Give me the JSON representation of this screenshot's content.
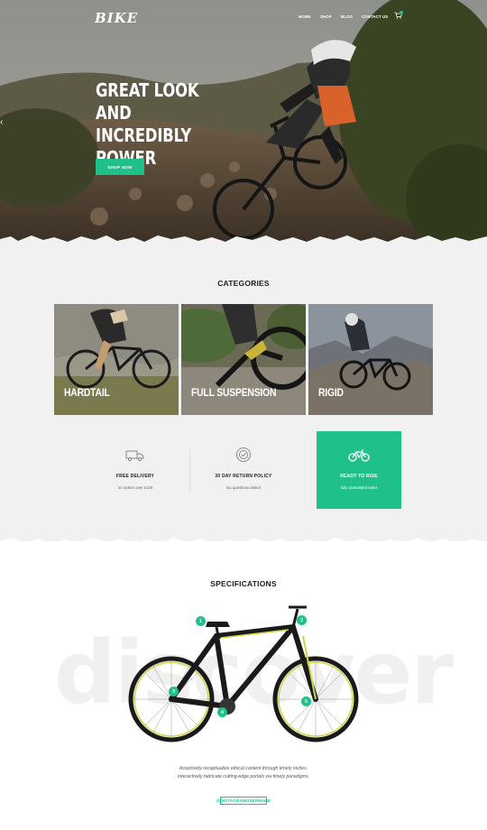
{
  "brand": {
    "logo": "BIKE"
  },
  "nav": {
    "items": [
      "HOME",
      "SHOP",
      "BLOG",
      "CONTACT US"
    ]
  },
  "hero": {
    "title_lines": [
      "GREAT LOOK",
      "AND INCREDIBLY",
      "POWER"
    ],
    "cta_label": "SHOP NOW"
  },
  "categories": {
    "title": "CATEGORIES",
    "items": [
      {
        "label": "HARDTAIL"
      },
      {
        "label": "FULL SUSPENSION"
      },
      {
        "label": "RIGID"
      }
    ]
  },
  "features": [
    {
      "icon": "truck-icon",
      "title": "FREE DELIVERY",
      "subtitle": "on orders over £100"
    },
    {
      "icon": "return-policy-icon",
      "title": "30 DAY RETURN POLICY",
      "subtitle": "No questions asked"
    },
    {
      "icon": "bike-icon",
      "title": "READY TO RIDE",
      "subtitle": "fully assembled bikes"
    }
  ],
  "specifications": {
    "title": "SPECIFICATIONS",
    "background_word": "discover",
    "hotspots": [
      "1",
      "2",
      "3",
      "4",
      "5"
    ],
    "description_lines": [
      "Assertively recaptiualize ethical content through timely niches.",
      "Interactively fabricate cutting-edge portals via timely paradigms."
    ],
    "instagram": "@INSTAGRAMUSERNAME"
  },
  "colors": {
    "accent": "#1fc08a",
    "background": "#f1f1f1"
  }
}
